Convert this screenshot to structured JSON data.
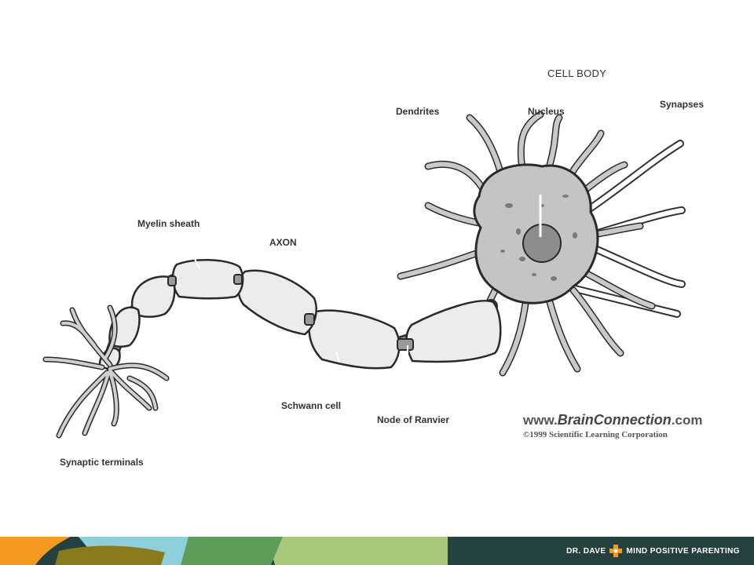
{
  "labels": {
    "cell_body": "CELL BODY",
    "synapses": "Synapses",
    "dendrites": "Dendrites",
    "nucleus": "Nucleus",
    "myelin_sheath": "Myelin sheath",
    "axon": "AXON",
    "schwann_cell": "Schwann cell",
    "node_of_ranvier": "Node of Ranvier",
    "synaptic_terminals": "Synaptic terminals"
  },
  "credit": {
    "url_prefix": "www.",
    "url_brand": "BrainConnection",
    "url_suffix": ".com",
    "copyright": "©1999 Scientific Learning Corporation"
  },
  "footer": {
    "name": "DR. DAVE",
    "tagline": "MIND POSITIVE PARENTING",
    "colors": {
      "orange": "#f39a1f",
      "light_blue": "#8ecfdc",
      "olive": "#8a7a1e",
      "green": "#5e9c5a",
      "light_green": "#a9c87a",
      "dark_teal": "#24403f"
    }
  }
}
